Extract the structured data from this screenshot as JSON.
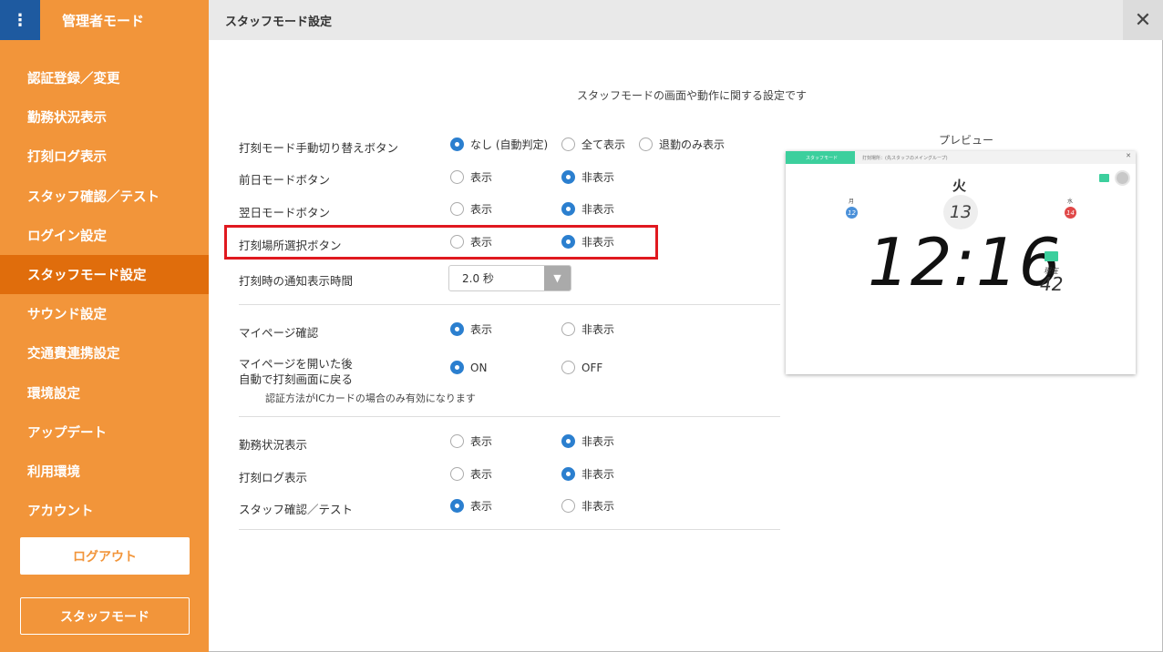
{
  "sidebar": {
    "menu_icon": "⋮",
    "title": "管理者モード",
    "items": [
      {
        "label": "認証登録／変更",
        "active": false
      },
      {
        "label": "勤務状況表示",
        "active": false
      },
      {
        "label": "打刻ログ表示",
        "active": false
      },
      {
        "label": "スタッフ確認／テスト",
        "active": false
      },
      {
        "label": "ログイン設定",
        "active": false
      },
      {
        "label": "スタッフモード設定",
        "active": true
      },
      {
        "label": "サウンド設定",
        "active": false
      },
      {
        "label": "交通費連携設定",
        "active": false
      },
      {
        "label": "環境設定",
        "active": false
      },
      {
        "label": "アップデート",
        "active": false
      },
      {
        "label": "利用環境",
        "active": false
      },
      {
        "label": "アカウント",
        "active": false
      }
    ],
    "logout_label": "ログアウト",
    "staff_mode_label": "スタッフモード"
  },
  "header": {
    "title": "スタッフモード設定",
    "close_icon": "✕"
  },
  "description": "スタッフモードの画面や動作に関する設定です",
  "settings": {
    "manual_switch": {
      "label": "打刻モード手動切り替えボタン",
      "opt1": "なし (自動判定)",
      "opt2": "全て表示",
      "opt3": "退勤のみ表示",
      "selected": 1
    },
    "prev_day": {
      "label": "前日モードボタン",
      "opt1": "表示",
      "opt2": "非表示",
      "selected": 2
    },
    "next_day": {
      "label": "翌日モードボタン",
      "opt1": "表示",
      "opt2": "非表示",
      "selected": 2
    },
    "location": {
      "label": "打刻場所選択ボタン",
      "opt1": "表示",
      "opt2": "非表示",
      "selected": 2
    },
    "notify_time": {
      "label": "打刻時の通知表示時間",
      "value": "2.0 秒"
    },
    "mypage": {
      "label": "マイページ確認",
      "opt1": "表示",
      "opt2": "非表示",
      "selected": 1
    },
    "mypage_return": {
      "label_line1": "マイページを開いた後",
      "label_line2": "自動で打刻画面に戻る",
      "opt1": "ON",
      "opt2": "OFF",
      "selected": 1,
      "note": "認証方法がICカードの場合のみ有効になります"
    },
    "work_status": {
      "label": "勤務状況表示",
      "opt1": "表示",
      "opt2": "非表示",
      "selected": 2
    },
    "punch_log": {
      "label": "打刻ログ表示",
      "opt1": "表示",
      "opt2": "非表示",
      "selected": 2
    },
    "staff_check": {
      "label": "スタッフ確認／テスト",
      "opt1": "表示",
      "opt2": "非表示",
      "selected": 1
    }
  },
  "preview": {
    "label": "プレビュー",
    "mode_tab": "スタッフモード",
    "location_text": "打刻場所：(先スタッフのメイングループ)",
    "weekday": "火",
    "day_current": "13",
    "prev_weekday": "月",
    "prev_day": "12",
    "next_weekday": "水",
    "next_day": "14",
    "time": "12:16",
    "now_label": "現在",
    "now_count": "42",
    "colors": {
      "tab": "#3ccf9d",
      "prev_day": "#4a90d9",
      "next_day": "#e04848"
    }
  },
  "colors": {
    "sidebar": "#f2953a",
    "active": "#e06d0c",
    "menu_button": "#1e5aa0",
    "radio": "#2b7fcf",
    "highlight": "#e0191f"
  }
}
